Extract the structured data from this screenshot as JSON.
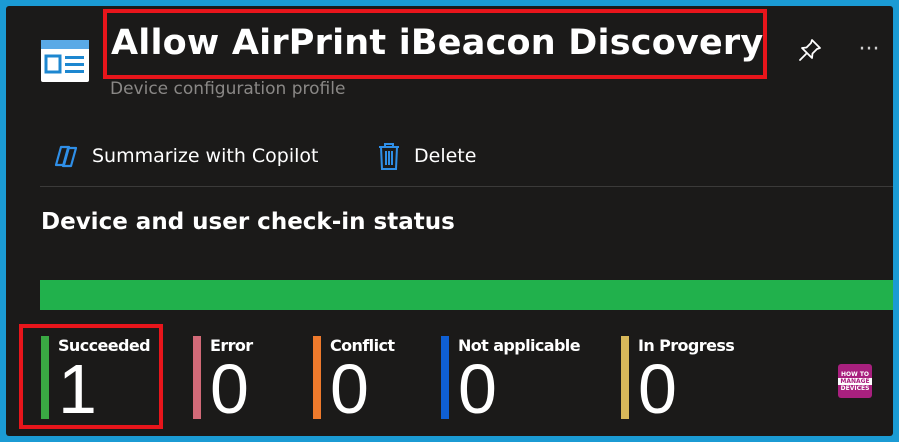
{
  "header": {
    "title": "Allow AirPrint iBeacon Discovery",
    "subtitle": "Device configuration profile",
    "pin_icon": "pin-icon",
    "more_icon": "more-icon",
    "more_glyph": "···"
  },
  "toolbar": {
    "copilot_label": "Summarize with Copilot",
    "delete_label": "Delete"
  },
  "status": {
    "title": "Device and user check-in status",
    "progress_percent": 100,
    "progress_color": "#21b14c",
    "items": [
      {
        "label": "Succeeded",
        "value": "1",
        "color": "#3aa843"
      },
      {
        "label": "Error",
        "value": "0",
        "color": "#d26a78"
      },
      {
        "label": "Conflict",
        "value": "0",
        "color": "#ee7a2c"
      },
      {
        "label": "Not applicable",
        "value": "0",
        "color": "#0f5fd3"
      },
      {
        "label": "In Progress",
        "value": "0",
        "color": "#d8b85a"
      }
    ]
  },
  "watermark": {
    "line1": "HOW TO",
    "line2": "MANAGE",
    "line3": "DEVICES"
  }
}
